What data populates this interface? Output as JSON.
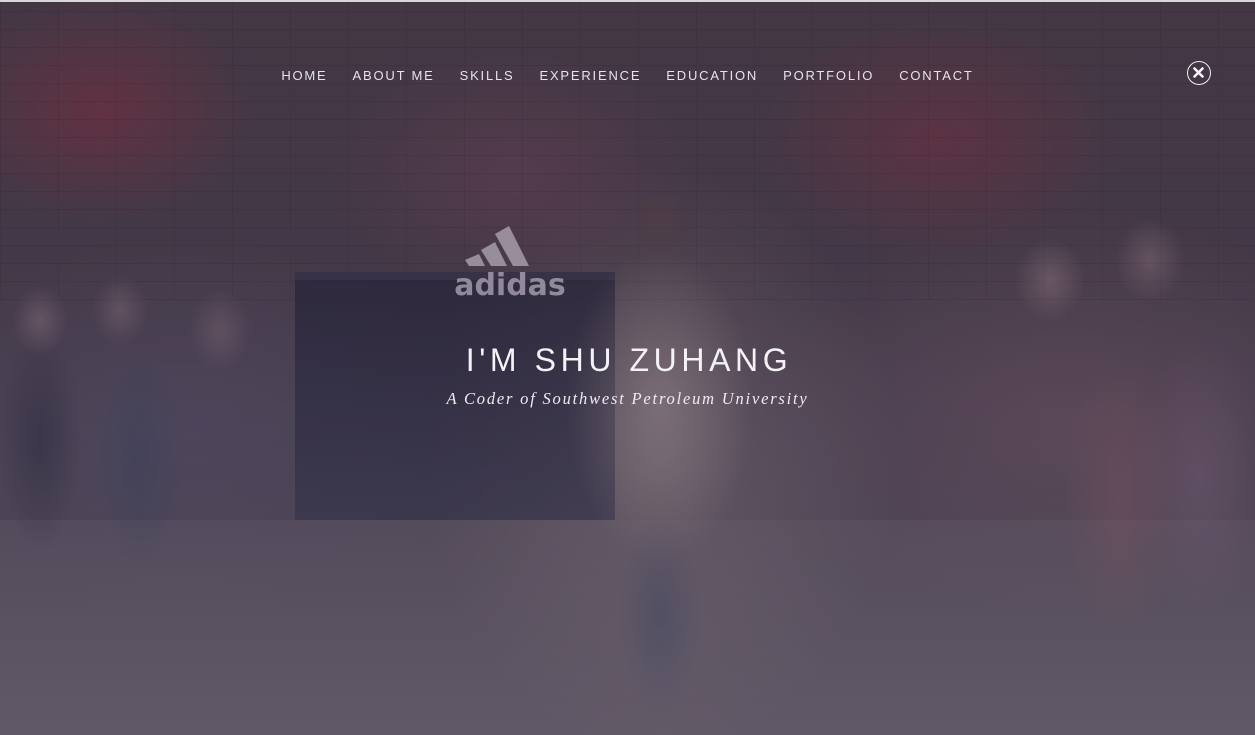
{
  "nav": {
    "items": [
      {
        "label": "HOME"
      },
      {
        "label": "ABOUT ME"
      },
      {
        "label": "SKILLS"
      },
      {
        "label": "EXPERIENCE"
      },
      {
        "label": "EDUCATION"
      },
      {
        "label": "PORTFOLIO"
      },
      {
        "label": "CONTACT"
      }
    ],
    "close_icon": "close-circle-icon"
  },
  "hero": {
    "title": "I'M SHU ZUHANG",
    "subtitle": "A Coder of Southwest Petroleum University",
    "background_logo": "adidas"
  },
  "colors": {
    "text": "#f4f2f6",
    "overlay": "#3a3340"
  }
}
